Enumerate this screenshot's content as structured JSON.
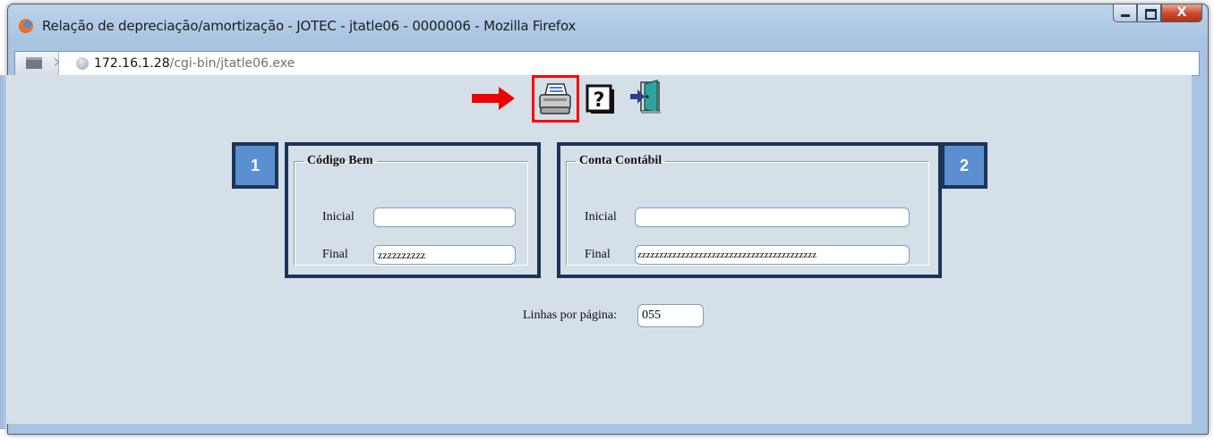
{
  "window": {
    "title": "Relação de depreciação/amortização - JOTEC - jtatle06 - 0000006 - Mozilla Firefox",
    "minimize_glyph": "",
    "maximize_glyph": "",
    "close_glyph": "X"
  },
  "addressbar": {
    "url_host": "172.16.1.28",
    "url_path": "/cgi-bin/jtatle06.exe"
  },
  "toolbar": {
    "icons": [
      "printer-icon",
      "help-icon",
      "exit-icon"
    ]
  },
  "codigo_bem": {
    "legend": "Código Bem",
    "badge": "1",
    "inicial_label": "Inicial",
    "inicial_value": "",
    "final_label": "Final",
    "final_value": "zzzzzzzzzz"
  },
  "conta_contabil": {
    "legend": "Conta Contábil",
    "badge": "2",
    "inicial_label": "Inicial",
    "inicial_value": "",
    "final_label": "Final",
    "final_value": "zzzzzzzzzzzzzzzzzzzzzzzzzzzzzzzzzzzzzzzzz"
  },
  "linhas": {
    "label": "Linhas por página:",
    "value": "055"
  },
  "colors": {
    "content_bg": "#d5dfe8",
    "annotation_border": "#1b3558",
    "badge_bg": "#5b8fd0",
    "highlight": "#ff0000"
  }
}
